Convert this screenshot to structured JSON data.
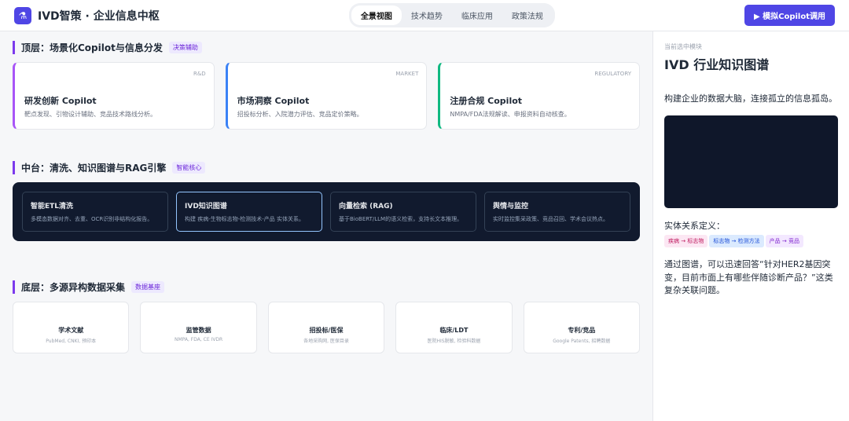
{
  "app": "IVD智策 · 企业信息中枢",
  "tabs": [
    "全景视图",
    "技术趋势",
    "临床应用",
    "政策法规"
  ],
  "cta": "模拟Copilot调用",
  "l1": {
    "title": "顶层：场景化Copilot与信息分发",
    "tag": "决策辅助",
    "cards": [
      {
        "k": "R&D",
        "t": "研发创新 Copilot",
        "d": "靶点发现、引物设计辅助、竞品技术路线分析。"
      },
      {
        "k": "MARKET",
        "t": "市场洞察 Copilot",
        "d": "招投标分析、入院潜力评估、竞品定价策略。"
      },
      {
        "k": "REGULATORY",
        "t": "注册合规 Copilot",
        "d": "NMPA/FDA法规解读、申报资料自动核查。"
      }
    ]
  },
  "l2": {
    "title": "中台：清洗、知识图谱与RAG引擎",
    "tag": "智能核心",
    "cards": [
      {
        "t": "智能ETL清洗",
        "d": "多模态数据对齐、去重、OCR识别非结构化报告。"
      },
      {
        "t": "IVD知识图谱",
        "d": "构建 疾病-生物标志物-检测技术-产品 实体关系。"
      },
      {
        "t": "向量检索 (RAG)",
        "d": "基于BioBERT/LLM的语义检索，支持长文本推理。"
      },
      {
        "t": "舆情与监控",
        "d": "实时监控集采政策、竞品召回、学术会议热点。"
      }
    ]
  },
  "l3": {
    "title": "底层：多源异构数据采集",
    "tag": "数据基座",
    "cards": [
      {
        "t": "学术文献",
        "d": "PubMed, CNKI, 预印本"
      },
      {
        "t": "监管数据",
        "d": "NMPA, FDA, CE IVDR"
      },
      {
        "t": "招投标/医保",
        "d": "各地采购网, 医保目录"
      },
      {
        "t": "临床/LDT",
        "d": "医院HIS脱敏, 检验科数据"
      },
      {
        "t": "专利/竞品",
        "d": "Google Patents, 招聘数据"
      }
    ]
  },
  "side": {
    "s1": "当前选中模块",
    "s2": "IVD 行业知识图谱",
    "desc": "构建企业的数据大脑，连接孤立的信息孤岛。",
    "rel": "实体关系定义：",
    "pills": [
      "疾病 → 标志物",
      "标志物 → 检测方法",
      "产品 → 竞品"
    ],
    "note": "通过图谱，可以迅速回答“针对HER2基因突变，目前市面上有哪些伴随诊断产品？”这类复杂关联问题。"
  }
}
